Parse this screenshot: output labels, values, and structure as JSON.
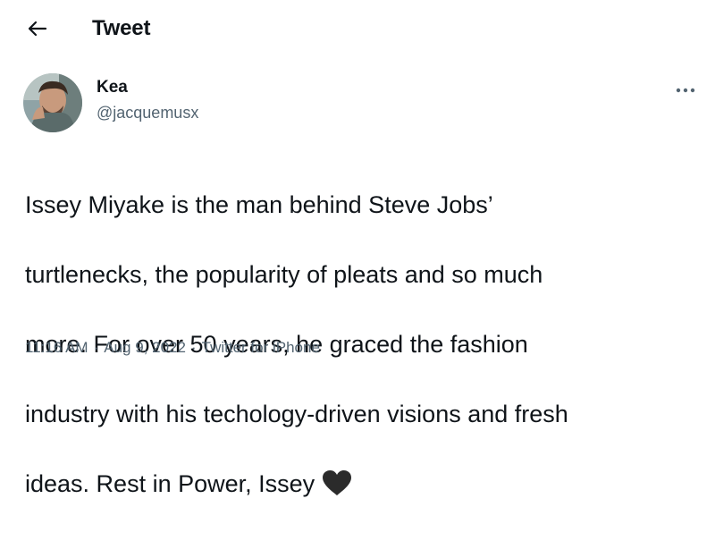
{
  "header": {
    "back_icon": "arrow-left-icon",
    "title": "Tweet"
  },
  "tweet": {
    "author": {
      "display_name": "Kea",
      "handle": "@jacquemusx"
    },
    "more_icon": "more-horizontal-icon",
    "text_lines": [
      "Issey Miyake is the man behind Steve Jobs’",
      "turtlenecks, the popularity of pleats and so much",
      "more. For over 50 years, he graced the fashion",
      "industry with his techology-driven visions and fresh",
      "ideas. Rest in Power, Issey"
    ],
    "emoji": "black-heart-icon",
    "time": "11:16 AM",
    "separator": "·",
    "date": "Aug 9, 2022",
    "source": "Twitter for iPhone"
  },
  "colors": {
    "text": "#0f1419",
    "secondary": "#536471",
    "background": "#ffffff"
  }
}
